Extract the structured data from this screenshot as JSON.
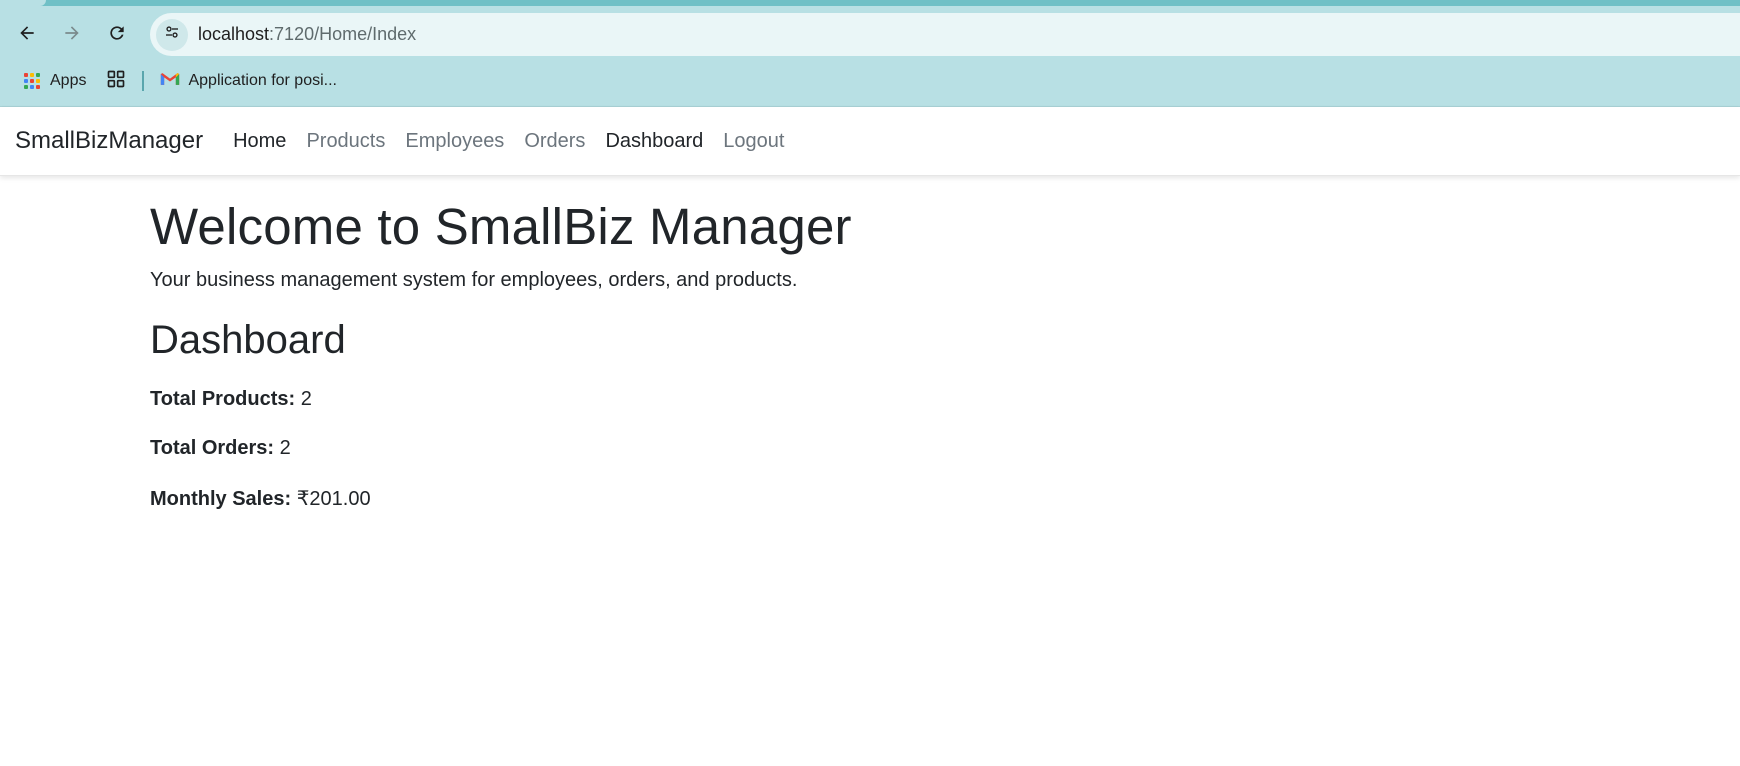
{
  "browser": {
    "url_host": "localhost",
    "url_path": ":7120/Home/Index",
    "bookmarks": {
      "apps_label": "Apps",
      "gmail_label": "Application for posi..."
    }
  },
  "navbar": {
    "brand": "SmallBizManager",
    "links": [
      {
        "label": "Home",
        "active": true
      },
      {
        "label": "Products",
        "active": false
      },
      {
        "label": "Employees",
        "active": false
      },
      {
        "label": "Orders",
        "active": false
      },
      {
        "label": "Dashboard",
        "active": true
      },
      {
        "label": "Logout",
        "active": false
      }
    ]
  },
  "main": {
    "title": "Welcome to SmallBiz Manager",
    "subtitle": "Your business management system for employees, orders, and products.",
    "dashboard_title": "Dashboard",
    "stats": [
      {
        "label": "Total Products:",
        "value": "2"
      },
      {
        "label": "Total Orders:",
        "value": "2"
      },
      {
        "label": "Monthly Sales:",
        "value": "₹201.00"
      }
    ]
  },
  "colors": {
    "chrome_bg": "#b8e0e4",
    "tab_strip": "#6fc0c6",
    "omnibox_bg": "#eaf6f7",
    "text_primary": "#212529",
    "text_muted": "#6c757d"
  },
  "icons": {
    "back": "back-arrow-icon",
    "forward": "forward-arrow-icon",
    "reload": "reload-icon",
    "site_info": "site-info-tune-icon",
    "apps": "apps-grid-icon",
    "tab_groups": "tab-groups-icon",
    "gmail": "gmail-icon"
  }
}
